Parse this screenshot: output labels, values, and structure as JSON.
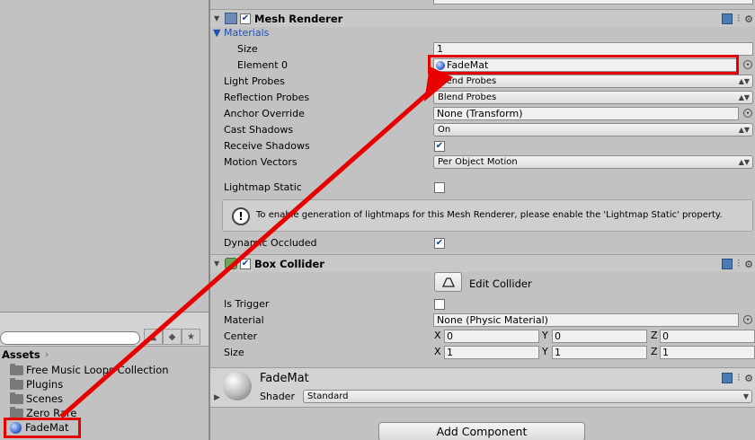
{
  "project": {
    "assets_title": "Assets",
    "items": [
      {
        "label": "Free Music Loops Collection",
        "icon": "folder-icon"
      },
      {
        "label": "Plugins",
        "icon": "folder-icon"
      },
      {
        "label": "Scenes",
        "icon": "folder-icon"
      },
      {
        "label": "Zero Rare",
        "icon": "folder-icon"
      },
      {
        "label": "FadeMat",
        "icon": "material-ball-icon"
      }
    ]
  },
  "mesh_renderer": {
    "title": "Mesh Renderer",
    "enabled": true,
    "materials_label": "Materials",
    "size_label": "Size",
    "size_value": "1",
    "element0_label": "Element 0",
    "element0_value": "FadeMat",
    "light_probes_label": "Light Probes",
    "light_probes_value": "Blend Probes",
    "reflection_probes_label": "Reflection Probes",
    "reflection_probes_value": "Blend Probes",
    "anchor_override_label": "Anchor Override",
    "anchor_override_value": "None (Transform)",
    "cast_shadows_label": "Cast Shadows",
    "cast_shadows_value": "On",
    "receive_shadows_label": "Receive Shadows",
    "receive_shadows_checked": true,
    "motion_vectors_label": "Motion Vectors",
    "motion_vectors_value": "Per Object Motion",
    "lightmap_static_label": "Lightmap Static",
    "lightmap_static_checked": false,
    "help_text": "To enable generation of lightmaps for this Mesh Renderer, please enable the 'Lightmap Static' property.",
    "dynamic_occluded_label": "Dynamic Occluded",
    "dynamic_occluded_checked": true
  },
  "box_collider": {
    "title": "Box Collider",
    "enabled": true,
    "edit_collider_label": "Edit Collider",
    "is_trigger_label": "Is Trigger",
    "is_trigger_checked": false,
    "material_label": "Material",
    "material_value": "None (Physic Material)",
    "center_label": "Center",
    "center": {
      "x": "0",
      "y": "0",
      "z": "0"
    },
    "size_label": "Size",
    "size": {
      "x": "1",
      "y": "1",
      "z": "1"
    },
    "axis_x": "X",
    "axis_y": "Y",
    "axis_z": "Z"
  },
  "material_panel": {
    "name": "FadeMat",
    "shader_label": "Shader",
    "shader_value": "Standard"
  },
  "add_component_label": "Add Component",
  "colors": {
    "highlight": "#e60000",
    "background": "#c2c2c2"
  }
}
